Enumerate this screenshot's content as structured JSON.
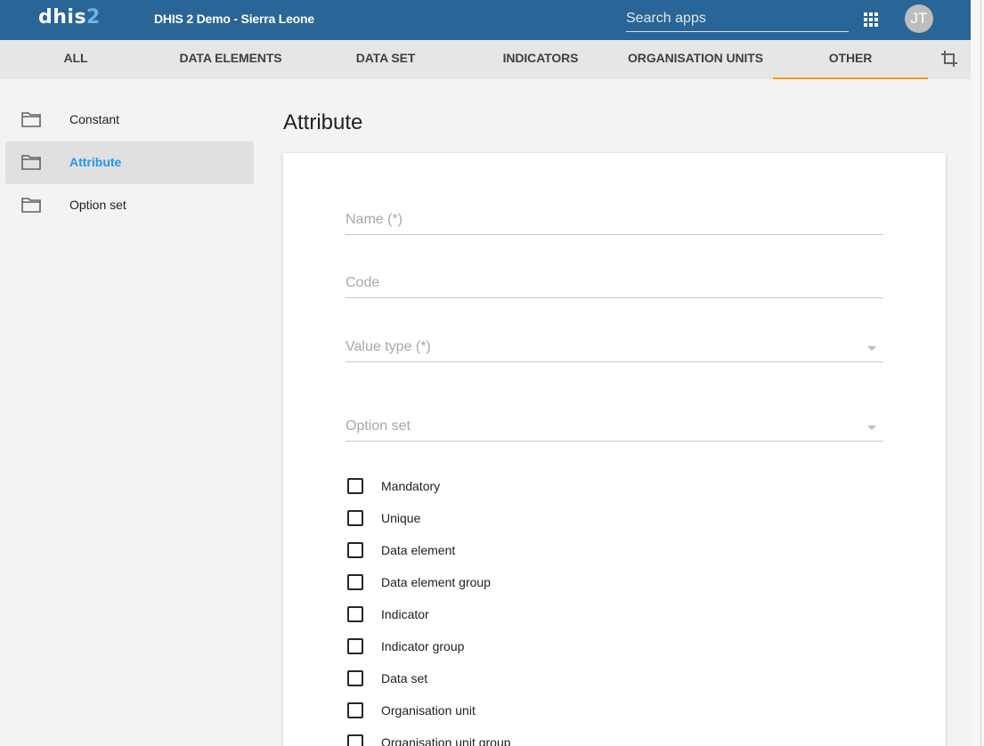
{
  "header": {
    "logo_text": "dhis",
    "logo_accent": "2",
    "app_title": "DHIS 2 Demo - Sierra Leone",
    "search_placeholder": "Search apps",
    "apps_icon": "apps-grid-icon",
    "avatar_initials": "JT",
    "bar_color": "#296596"
  },
  "tabs": [
    {
      "label": "ALL",
      "active": false
    },
    {
      "label": "DATA ELEMENTS",
      "active": false
    },
    {
      "label": "DATA SET",
      "active": false
    },
    {
      "label": "INDICATORS",
      "active": false
    },
    {
      "label": "ORGANISATION UNITS",
      "active": false
    },
    {
      "label": "OTHER",
      "active": true
    }
  ],
  "tabs_accent_color": "#ff9800",
  "crop_icon": "crop-icon",
  "sidebar": {
    "items": [
      {
        "label": "Constant",
        "icon": "folder-icon",
        "active": false
      },
      {
        "label": "Attribute",
        "icon": "folder-icon",
        "active": true
      },
      {
        "label": "Option set",
        "icon": "folder-icon",
        "active": false
      }
    ],
    "active_color": "#2196f3"
  },
  "main": {
    "title": "Attribute",
    "fields": [
      {
        "placeholder": "Name (*)",
        "type": "text"
      },
      {
        "placeholder": "Code",
        "type": "text"
      },
      {
        "placeholder": "Value type (*)",
        "type": "select"
      },
      {
        "placeholder": "Option set",
        "type": "select"
      }
    ],
    "checkboxes": [
      {
        "label": "Mandatory",
        "checked": false
      },
      {
        "label": "Unique",
        "checked": false
      },
      {
        "label": "Data element",
        "checked": false
      },
      {
        "label": "Data element group",
        "checked": false
      },
      {
        "label": "Indicator",
        "checked": false
      },
      {
        "label": "Indicator group",
        "checked": false
      },
      {
        "label": "Data set",
        "checked": false
      },
      {
        "label": "Organisation unit",
        "checked": false
      },
      {
        "label": "Organisation unit group",
        "checked": false
      }
    ]
  }
}
